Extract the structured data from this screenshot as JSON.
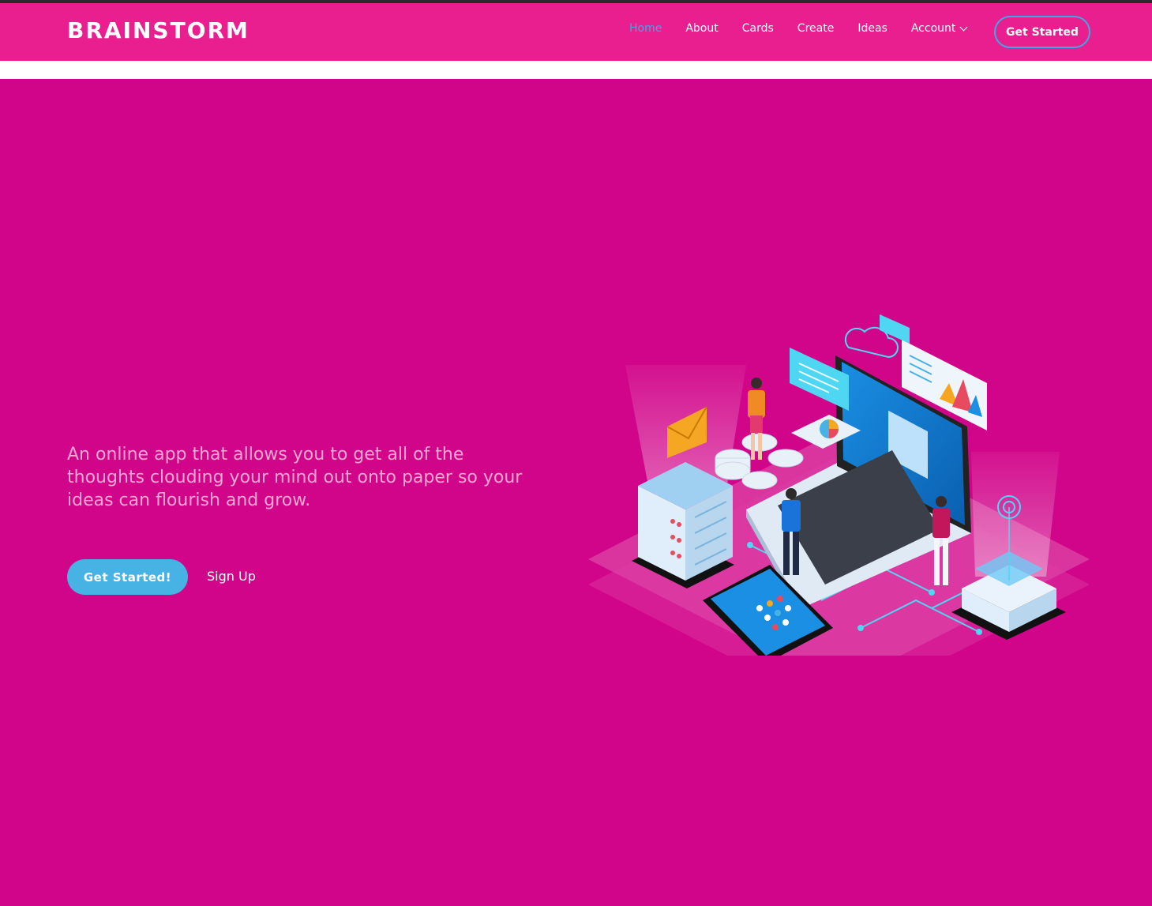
{
  "header": {
    "brand": "BRAINSTORM",
    "nav": [
      {
        "label": "Home",
        "active": true
      },
      {
        "label": "About"
      },
      {
        "label": "Cards"
      },
      {
        "label": "Create"
      },
      {
        "label": "Ideas"
      },
      {
        "label": "Account",
        "has_dropdown": true
      }
    ],
    "cta_label": "Get Started"
  },
  "hero": {
    "tagline": "An online app that allows you to get all of the thoughts clouding your mind out onto paper so your ideas can flourish and grow.",
    "primary_button": "Get Started!",
    "secondary_link": "Sign Up",
    "illustration": "isometric-tech-illustration"
  },
  "colors": {
    "navbar": "#e91e8f",
    "hero_background": "#d1058a",
    "accent": "#47b2e4",
    "tagline_text": "#f3a7d3"
  }
}
